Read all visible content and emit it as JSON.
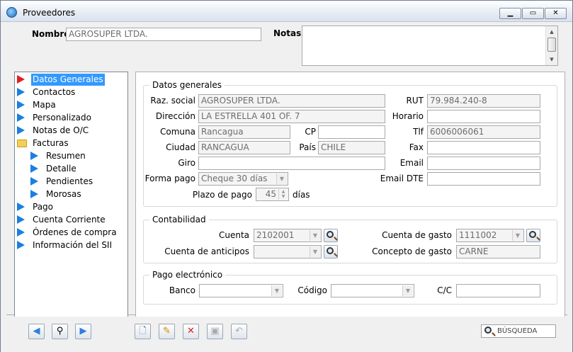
{
  "window": {
    "title": "Proveedores"
  },
  "header": {
    "nombre_label": "Nombre",
    "nombre_value": "AGROSUPER LTDA.",
    "notas_label": "Notas"
  },
  "tree": {
    "items": [
      {
        "label": "Datos Generales"
      },
      {
        "label": "Contactos"
      },
      {
        "label": "Mapa"
      },
      {
        "label": "Personalizado"
      },
      {
        "label": "Notas de O/C"
      },
      {
        "label": "Facturas"
      },
      {
        "label": "Resumen"
      },
      {
        "label": "Detalle"
      },
      {
        "label": "Pendientes"
      },
      {
        "label": "Morosas"
      },
      {
        "label": "Pago"
      },
      {
        "label": "Cuenta Corriente"
      },
      {
        "label": "Órdenes de compra"
      },
      {
        "label": "Información del SII"
      }
    ]
  },
  "datos": {
    "legend": "Datos generales",
    "razon_label": "Raz. social",
    "razon_value": "AGROSUPER LTDA.",
    "rut_label": "RUT",
    "rut_value": "79.984.240-8",
    "direccion_label": "Dirección",
    "direccion_value": "LA ESTRELLA 401 OF. 7",
    "horario_label": "Horario",
    "horario_value": "",
    "comuna_label": "Comuna",
    "comuna_value": "Rancagua",
    "cp_label": "CP",
    "cp_value": "",
    "tlf_label": "Tlf",
    "tlf_value": "6006006061",
    "ciudad_label": "Ciudad",
    "ciudad_value": "RANCAGUA",
    "pais_label": "País",
    "pais_value": "CHILE",
    "fax_label": "Fax",
    "fax_value": "",
    "giro_label": "Giro",
    "giro_value": "",
    "email_label": "Email",
    "email_value": "",
    "forma_pago_label": "Forma pago",
    "forma_pago_value": "Cheque 30 días",
    "email_dte_label": "Email DTE",
    "email_dte_value": "",
    "plazo_label": "Plazo de pago",
    "plazo_value": "45",
    "plazo_unit": "días"
  },
  "contabilidad": {
    "legend": "Contabilidad",
    "cuenta_label": "Cuenta",
    "cuenta_value": "2102001",
    "cuenta_gasto_label": "Cuenta de gasto",
    "cuenta_gasto_value": "1111002",
    "anticipos_label": "Cuenta de anticipos",
    "anticipos_value": "",
    "concepto_label": "Concepto de gasto",
    "concepto_value": "CARNE"
  },
  "pago": {
    "legend": "Pago electrónico",
    "banco_label": "Banco",
    "banco_value": "",
    "codigo_label": "Código",
    "codigo_value": "",
    "cc_label": "C/C",
    "cc_value": ""
  },
  "toolbar": {
    "search_placeholder": "BÚSQUEDA"
  }
}
